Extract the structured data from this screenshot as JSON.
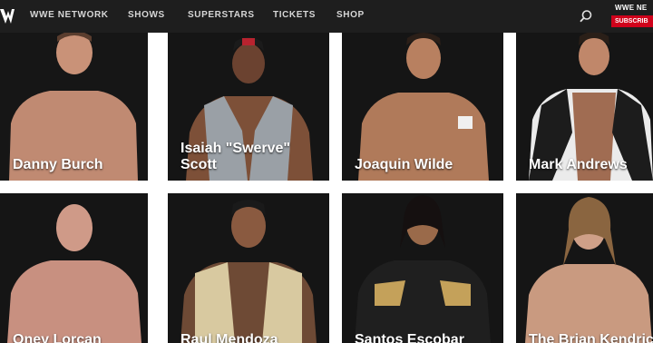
{
  "nav": {
    "items": [
      "WWE NETWORK",
      "SHOWS",
      "SUPERSTARS",
      "TICKETS",
      "SHOP"
    ],
    "network_label": "WWE NE",
    "subscribe_label": "SUBSCRIB",
    "search_icon": "search-icon",
    "logo_icon": "wwe-logo-icon"
  },
  "superstars": [
    {
      "name": "Danny Burch"
    },
    {
      "name": "Isaiah \"Swerve\"\nScott"
    },
    {
      "name": "Joaquin Wilde"
    },
    {
      "name": "Mark Andrews"
    },
    {
      "name": "Oney Lorcan"
    },
    {
      "name": "Raul Mendoza"
    },
    {
      "name": "Santos Escobar"
    },
    {
      "name": "The Brian Kendrick"
    }
  ],
  "colors": {
    "navbar": "#1e1e1e",
    "accent": "#d0021b",
    "card_bg": "#141414",
    "page_bg": "#ffffff"
  }
}
